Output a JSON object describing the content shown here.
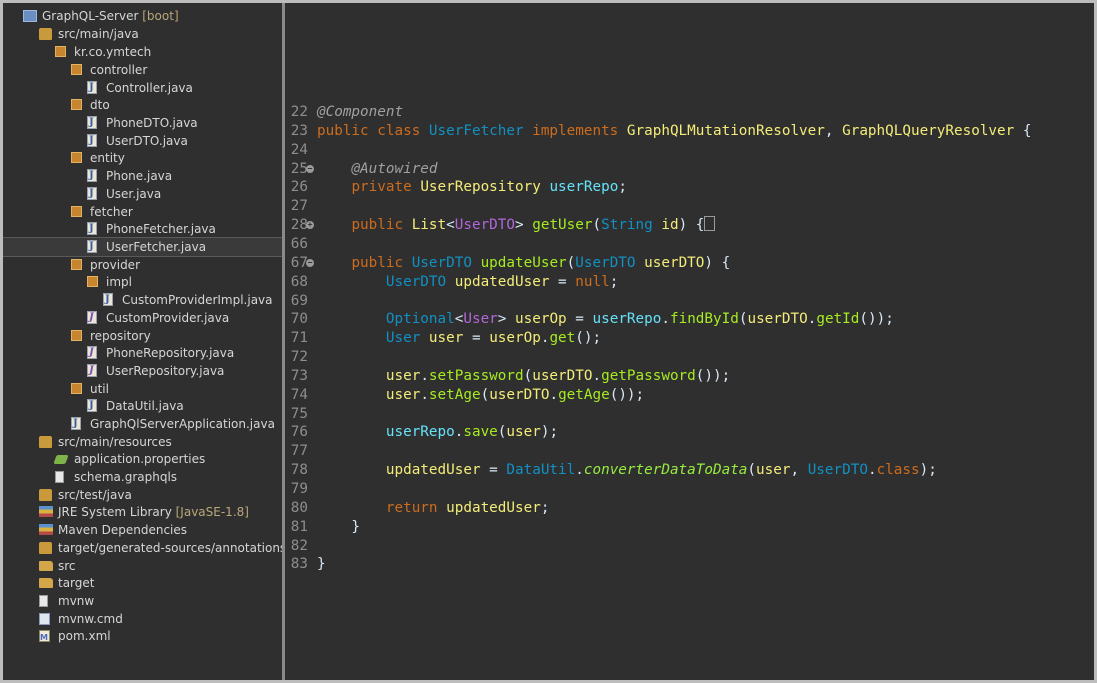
{
  "tree": {
    "items": [
      {
        "label": "GraphQL-Server",
        "deco": "[boot]",
        "toggle": "◢",
        "icon": "project-icon"
      },
      {
        "label": "src/main/java",
        "toggle": "◢",
        "icon": "source-folder-icon"
      },
      {
        "label": "kr.co.ymtech",
        "toggle": "◢",
        "icon": "package-icon"
      },
      {
        "label": "controller",
        "toggle": "◢",
        "icon": "package-icon"
      },
      {
        "label": "Controller.java",
        "toggle": "▷",
        "icon": "java-file-icon"
      },
      {
        "label": "dto",
        "toggle": "◢",
        "icon": "package-icon"
      },
      {
        "label": "PhoneDTO.java",
        "toggle": "▷",
        "icon": "java-file-icon"
      },
      {
        "label": "UserDTO.java",
        "toggle": "▷",
        "icon": "java-file-icon"
      },
      {
        "label": "entity",
        "toggle": "◢",
        "icon": "package-icon"
      },
      {
        "label": "Phone.java",
        "toggle": "▷",
        "icon": "java-file-icon"
      },
      {
        "label": "User.java",
        "toggle": "▷",
        "icon": "java-file-icon"
      },
      {
        "label": "fetcher",
        "toggle": "◢",
        "icon": "package-icon"
      },
      {
        "label": "PhoneFetcher.java",
        "toggle": "▷",
        "icon": "java-file-icon"
      },
      {
        "label": "UserFetcher.java",
        "toggle": "▷",
        "icon": "java-file-icon"
      },
      {
        "label": "provider",
        "toggle": "◢",
        "icon": "package-icon"
      },
      {
        "label": "impl",
        "toggle": "◢",
        "icon": "package-icon"
      },
      {
        "label": "CustomProviderImpl.java",
        "toggle": "▷",
        "icon": "java-file-icon"
      },
      {
        "label": "CustomProvider.java",
        "toggle": "▷",
        "icon": "interface-file-icon"
      },
      {
        "label": "repository",
        "toggle": "◢",
        "icon": "package-icon"
      },
      {
        "label": "PhoneRepository.java",
        "toggle": "▷",
        "icon": "interface-file-icon"
      },
      {
        "label": "UserRepository.java",
        "toggle": "▷",
        "icon": "interface-file-icon"
      },
      {
        "label": "util",
        "toggle": "◢",
        "icon": "package-icon"
      },
      {
        "label": "DataUtil.java",
        "toggle": "▷",
        "icon": "java-file-icon"
      },
      {
        "label": "GraphQlServerApplication.java",
        "toggle": "▷",
        "icon": "java-file-icon"
      },
      {
        "label": "src/main/resources",
        "toggle": "◢",
        "icon": "source-folder-icon"
      },
      {
        "label": "application.properties",
        "toggle": "",
        "icon": "properties-file-icon"
      },
      {
        "label": "schema.graphqls",
        "toggle": "",
        "icon": "file-icon"
      },
      {
        "label": "src/test/java",
        "toggle": "▷",
        "icon": "source-folder-icon"
      },
      {
        "label": "JRE System Library",
        "deco": "[JavaSE-1.8]",
        "toggle": "▷",
        "icon": "library-icon"
      },
      {
        "label": "Maven Dependencies",
        "toggle": "▷",
        "icon": "library-icon"
      },
      {
        "label": "target/generated-sources/annotations",
        "toggle": "",
        "icon": "source-folder-icon"
      },
      {
        "label": "src",
        "toggle": "▷",
        "icon": "folder-icon"
      },
      {
        "label": "target",
        "toggle": "▷",
        "icon": "folder-icon"
      },
      {
        "label": "mvnw",
        "toggle": "",
        "icon": "file-icon"
      },
      {
        "label": "mvnw.cmd",
        "toggle": "",
        "icon": "cmd-file-icon"
      },
      {
        "label": "pom.xml",
        "toggle": "",
        "icon": "maven-pom-icon"
      }
    ]
  },
  "editor": {
    "lines": [
      {
        "n": "22",
        "fold": "",
        "tokens": [
          [
            "an",
            "@Component"
          ]
        ]
      },
      {
        "n": "23",
        "fold": "",
        "tokens": [
          [
            "kw",
            "public"
          ],
          [
            "pl",
            " "
          ],
          [
            "kw",
            "class"
          ],
          [
            "pl",
            " "
          ],
          [
            "ty",
            "UserFetcher"
          ],
          [
            "pl",
            " "
          ],
          [
            "kw",
            "implements"
          ],
          [
            "pl",
            " "
          ],
          [
            "var",
            "GraphQLMutationResolver"
          ],
          [
            "pl",
            ", "
          ],
          [
            "var",
            "GraphQLQueryResolver"
          ],
          [
            "pl",
            " {"
          ]
        ]
      },
      {
        "n": "24",
        "fold": "",
        "tokens": []
      },
      {
        "n": "25",
        "fold": "−",
        "tokens": [
          [
            "pl",
            "    "
          ],
          [
            "an",
            "@Autowired"
          ]
        ]
      },
      {
        "n": "26",
        "fold": "",
        "tokens": [
          [
            "pl",
            "    "
          ],
          [
            "kw",
            "private"
          ],
          [
            "pl",
            " "
          ],
          [
            "var",
            "UserRepository"
          ],
          [
            "pl",
            " "
          ],
          [
            "fld",
            "userRepo"
          ],
          [
            "pl",
            ";"
          ]
        ]
      },
      {
        "n": "27",
        "fold": "",
        "tokens": []
      },
      {
        "n": "28",
        "fold": "+",
        "tokens": [
          [
            "pl",
            "    "
          ],
          [
            "kw",
            "public"
          ],
          [
            "pl",
            " "
          ],
          [
            "var",
            "List"
          ],
          [
            "pl",
            "<"
          ],
          [
            "iface",
            "UserDTO"
          ],
          [
            "pl",
            "> "
          ],
          [
            "mth",
            "getUser"
          ],
          [
            "pl",
            "("
          ],
          [
            "ty",
            "String"
          ],
          [
            "pl",
            " "
          ],
          [
            "var",
            "id"
          ],
          [
            "pl",
            ") {"
          ],
          [
            "box",
            ""
          ]
        ]
      },
      {
        "n": "66",
        "fold": "",
        "tokens": []
      },
      {
        "n": "67",
        "fold": "−",
        "tokens": [
          [
            "pl",
            "    "
          ],
          [
            "kw",
            "public"
          ],
          [
            "pl",
            " "
          ],
          [
            "ty",
            "UserDTO"
          ],
          [
            "pl",
            " "
          ],
          [
            "mth",
            "updateUser"
          ],
          [
            "pl",
            "("
          ],
          [
            "ty",
            "UserDTO"
          ],
          [
            "pl",
            " "
          ],
          [
            "var",
            "userDTO"
          ],
          [
            "pl",
            ") {"
          ]
        ]
      },
      {
        "n": "68",
        "fold": "",
        "tokens": [
          [
            "pl",
            "        "
          ],
          [
            "ty",
            "UserDTO"
          ],
          [
            "pl",
            " "
          ],
          [
            "var",
            "updatedUser"
          ],
          [
            "pl",
            " = "
          ],
          [
            "kw",
            "null"
          ],
          [
            "pl",
            ";"
          ]
        ]
      },
      {
        "n": "69",
        "fold": "",
        "tokens": []
      },
      {
        "n": "70",
        "fold": "",
        "tokens": [
          [
            "pl",
            "        "
          ],
          [
            "ty",
            "Optional"
          ],
          [
            "pl",
            "<"
          ],
          [
            "iface",
            "User"
          ],
          [
            "pl",
            "> "
          ],
          [
            "var",
            "userOp"
          ],
          [
            "pl",
            " = "
          ],
          [
            "fld",
            "userRepo"
          ],
          [
            "pl",
            "."
          ],
          [
            "mth",
            "findById"
          ],
          [
            "pl",
            "("
          ],
          [
            "var",
            "userDTO"
          ],
          [
            "pl",
            "."
          ],
          [
            "mth",
            "getId"
          ],
          [
            "pl",
            "());"
          ]
        ]
      },
      {
        "n": "71",
        "fold": "",
        "tokens": [
          [
            "pl",
            "        "
          ],
          [
            "ty",
            "User"
          ],
          [
            "pl",
            " "
          ],
          [
            "var",
            "user"
          ],
          [
            "pl",
            " = "
          ],
          [
            "var",
            "userOp"
          ],
          [
            "pl",
            "."
          ],
          [
            "mth",
            "get"
          ],
          [
            "pl",
            "();"
          ]
        ]
      },
      {
        "n": "72",
        "fold": "",
        "tokens": []
      },
      {
        "n": "73",
        "fold": "",
        "tokens": [
          [
            "pl",
            "        "
          ],
          [
            "var",
            "user"
          ],
          [
            "pl",
            "."
          ],
          [
            "mth",
            "setPassword"
          ],
          [
            "pl",
            "("
          ],
          [
            "var",
            "userDTO"
          ],
          [
            "pl",
            "."
          ],
          [
            "mth",
            "getPassword"
          ],
          [
            "pl",
            "());"
          ]
        ]
      },
      {
        "n": "74",
        "fold": "",
        "tokens": [
          [
            "pl",
            "        "
          ],
          [
            "var",
            "user"
          ],
          [
            "pl",
            "."
          ],
          [
            "mth",
            "setAge"
          ],
          [
            "pl",
            "("
          ],
          [
            "var",
            "userDTO"
          ],
          [
            "pl",
            "."
          ],
          [
            "mth",
            "getAge"
          ],
          [
            "pl",
            "());"
          ]
        ]
      },
      {
        "n": "75",
        "fold": "",
        "tokens": []
      },
      {
        "n": "76",
        "fold": "",
        "tokens": [
          [
            "pl",
            "        "
          ],
          [
            "fld",
            "userRepo"
          ],
          [
            "pl",
            "."
          ],
          [
            "mth",
            "save"
          ],
          [
            "pl",
            "("
          ],
          [
            "var",
            "user"
          ],
          [
            "pl",
            ");"
          ]
        ]
      },
      {
        "n": "77",
        "fold": "",
        "tokens": []
      },
      {
        "n": "78",
        "fold": "",
        "tokens": [
          [
            "pl",
            "        "
          ],
          [
            "var",
            "updatedUser"
          ],
          [
            "pl",
            " = "
          ],
          [
            "ty",
            "DataUtil"
          ],
          [
            "pl",
            "."
          ],
          [
            "st",
            "converterDataToData"
          ],
          [
            "pl",
            "("
          ],
          [
            "var",
            "user"
          ],
          [
            "pl",
            ", "
          ],
          [
            "ty",
            "UserDTO"
          ],
          [
            "pl",
            "."
          ],
          [
            "kw",
            "class"
          ],
          [
            "pl",
            ");"
          ]
        ]
      },
      {
        "n": "79",
        "fold": "",
        "tokens": []
      },
      {
        "n": "80",
        "fold": "",
        "tokens": [
          [
            "pl",
            "        "
          ],
          [
            "kw",
            "return"
          ],
          [
            "pl",
            " "
          ],
          [
            "var",
            "updatedUser"
          ],
          [
            "pl",
            ";"
          ]
        ]
      },
      {
        "n": "81",
        "fold": "",
        "tokens": [
          [
            "pl",
            "    }"
          ]
        ]
      },
      {
        "n": "82",
        "fold": "",
        "tokens": []
      },
      {
        "n": "83",
        "fold": "",
        "tokens": [
          [
            "pl",
            "}"
          ]
        ]
      }
    ]
  }
}
